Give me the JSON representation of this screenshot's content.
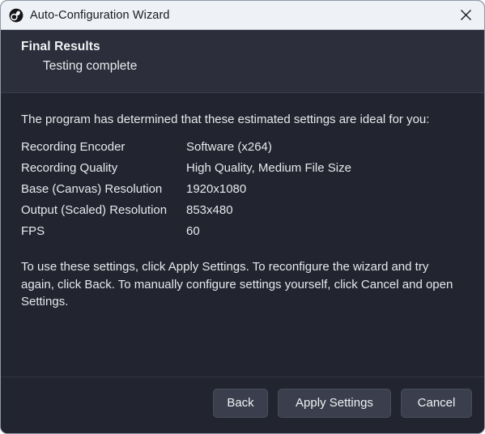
{
  "window": {
    "title": "Auto-Configuration Wizard",
    "app_icon": "obs-logo-icon",
    "close_icon": "close-icon"
  },
  "header": {
    "title": "Final Results",
    "subtitle": "Testing complete"
  },
  "content": {
    "intro_paragraph": "The program has determined that these estimated settings are ideal for you:",
    "settings": [
      {
        "label": "Recording Encoder",
        "value": "Software (x264)"
      },
      {
        "label": "Recording Quality",
        "value": "High Quality, Medium File Size"
      },
      {
        "label": "Base (Canvas) Resolution",
        "value": "1920x1080"
      },
      {
        "label": "Output (Scaled) Resolution",
        "value": "853x480"
      },
      {
        "label": "FPS",
        "value": "60"
      }
    ],
    "outro_paragraph": "To use these settings, click Apply Settings. To reconfigure the wizard and try again, click Back. To manually configure settings yourself, click Cancel and open Settings."
  },
  "footer": {
    "back_label": "Back",
    "apply_label": "Apply Settings",
    "cancel_label": "Cancel"
  },
  "colors": {
    "titlebar_bg": "#eef1f6",
    "header_bg": "#2c2f3b",
    "body_bg": "#22242f",
    "button_bg": "#3b3f4d",
    "text": "#e7e9ee"
  }
}
